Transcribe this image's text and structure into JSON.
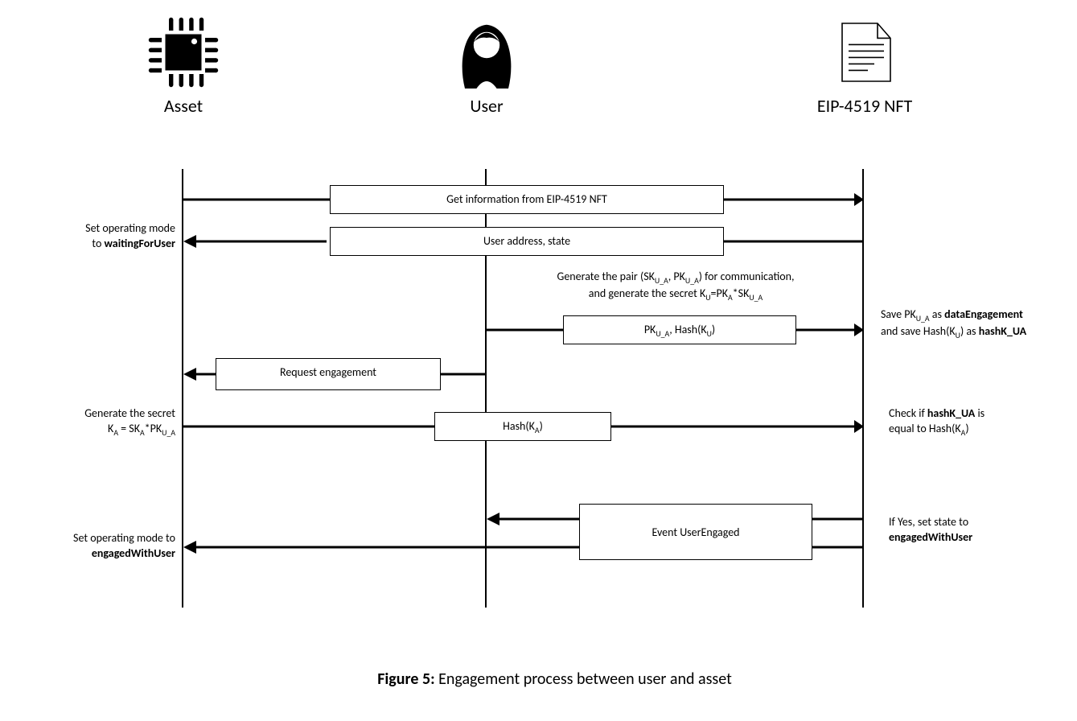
{
  "actors": {
    "asset": "Asset",
    "user": "User",
    "nft": "EIP-4519 NFT"
  },
  "messages": {
    "m1": "Get information from EIP-4519 NFT",
    "m2": "User address, state",
    "m4_html": "PK<sub>U_A</sub>, Hash(K<sub>U</sub>)",
    "m5": "Request engagement",
    "m6_html": "Hash(K<sub>A</sub>)",
    "m7": "Event  UserEngaged"
  },
  "notes": {
    "n_left_m2_html": "Set operating mode<br>to <b>waitingForUser</b>",
    "n_center_m3_html": "Generate the pair (SK<sub>U_A</sub>, PK<sub>U_A</sub>) for communication,<br>and generate the secret K<sub>U</sub>=PK<sub>A</sub>*SK<sub>U_A</sub>",
    "n_right_m4_html": "Save PK<sub>U_A</sub> as <b>dataEngagement</b><br>and save Hash(K<sub>U</sub>) as <b>hashK_UA</b>",
    "n_left_m6_html": "Generate the secret<br>K<sub>A</sub> = SK<sub>A</sub>*PK<sub>U_A</sub>",
    "n_right_m6_html": "Check if <b>hashK_UA</b> is<br>equal to Hash(K<sub>A</sub>)",
    "n_right_m7_html": "If Yes, set state to<br><b>engagedWithUser</b>",
    "n_left_m7_html": "Set operating mode to<br><b>engagedWithUser</b>"
  },
  "caption_html": "<b>Figure 5:</b> Engagement process between user and asset"
}
